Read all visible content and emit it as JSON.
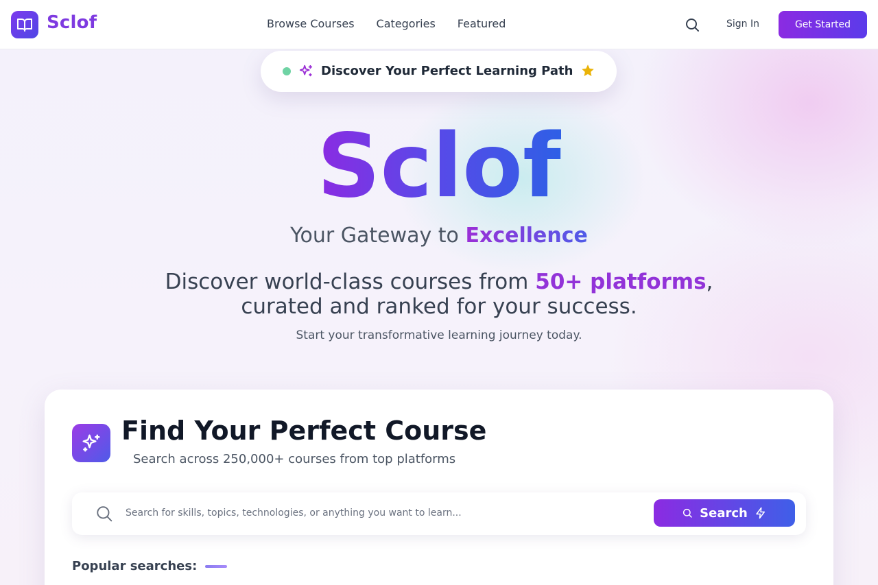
{
  "brand": {
    "name": "Sclof"
  },
  "nav": {
    "items": [
      "Browse Courses",
      "Categories",
      "Featured"
    ]
  },
  "header": {
    "sign_in": "Sign In",
    "get_started": "Get Started"
  },
  "badge": {
    "text": "Discover Your Perfect Learning Path"
  },
  "hero": {
    "title": "Sclof",
    "subtitle_prefix": "Your Gateway to",
    "subtitle_accent": "Excellence",
    "desc_prefix": "Discover world-class courses from",
    "desc_accent": "50+ platforms",
    "desc_comma": ",",
    "desc_line2": "curated and ranked for your success.",
    "tagline": "Start your transformative learning journey today."
  },
  "finder": {
    "title": "Find Your Perfect Course",
    "subtitle": "Search across 250,000+ courses from top platforms",
    "search_placeholder": "Search for skills, topics, technologies, or anything you want to learn...",
    "search_value": "",
    "search_button": "Search",
    "popular_label": "Popular searches:"
  },
  "icons": {
    "logo": "book-icon",
    "header_search": "search-icon",
    "badge_sparkle": "sparkle-icon",
    "badge_star": "star-icon",
    "finder": "sparkle-icon",
    "search_field": "search-icon",
    "search_button_lead": "search-icon",
    "search_button_trail": "lightning-icon"
  },
  "colors": {
    "brand_purple": "#7e3ae0",
    "gradient_start": "#8b2be2",
    "gradient_end": "#2f5fe6",
    "accent_violet": "#9233d8",
    "status_dot": "#6fd3a4",
    "star": "#eab308"
  }
}
